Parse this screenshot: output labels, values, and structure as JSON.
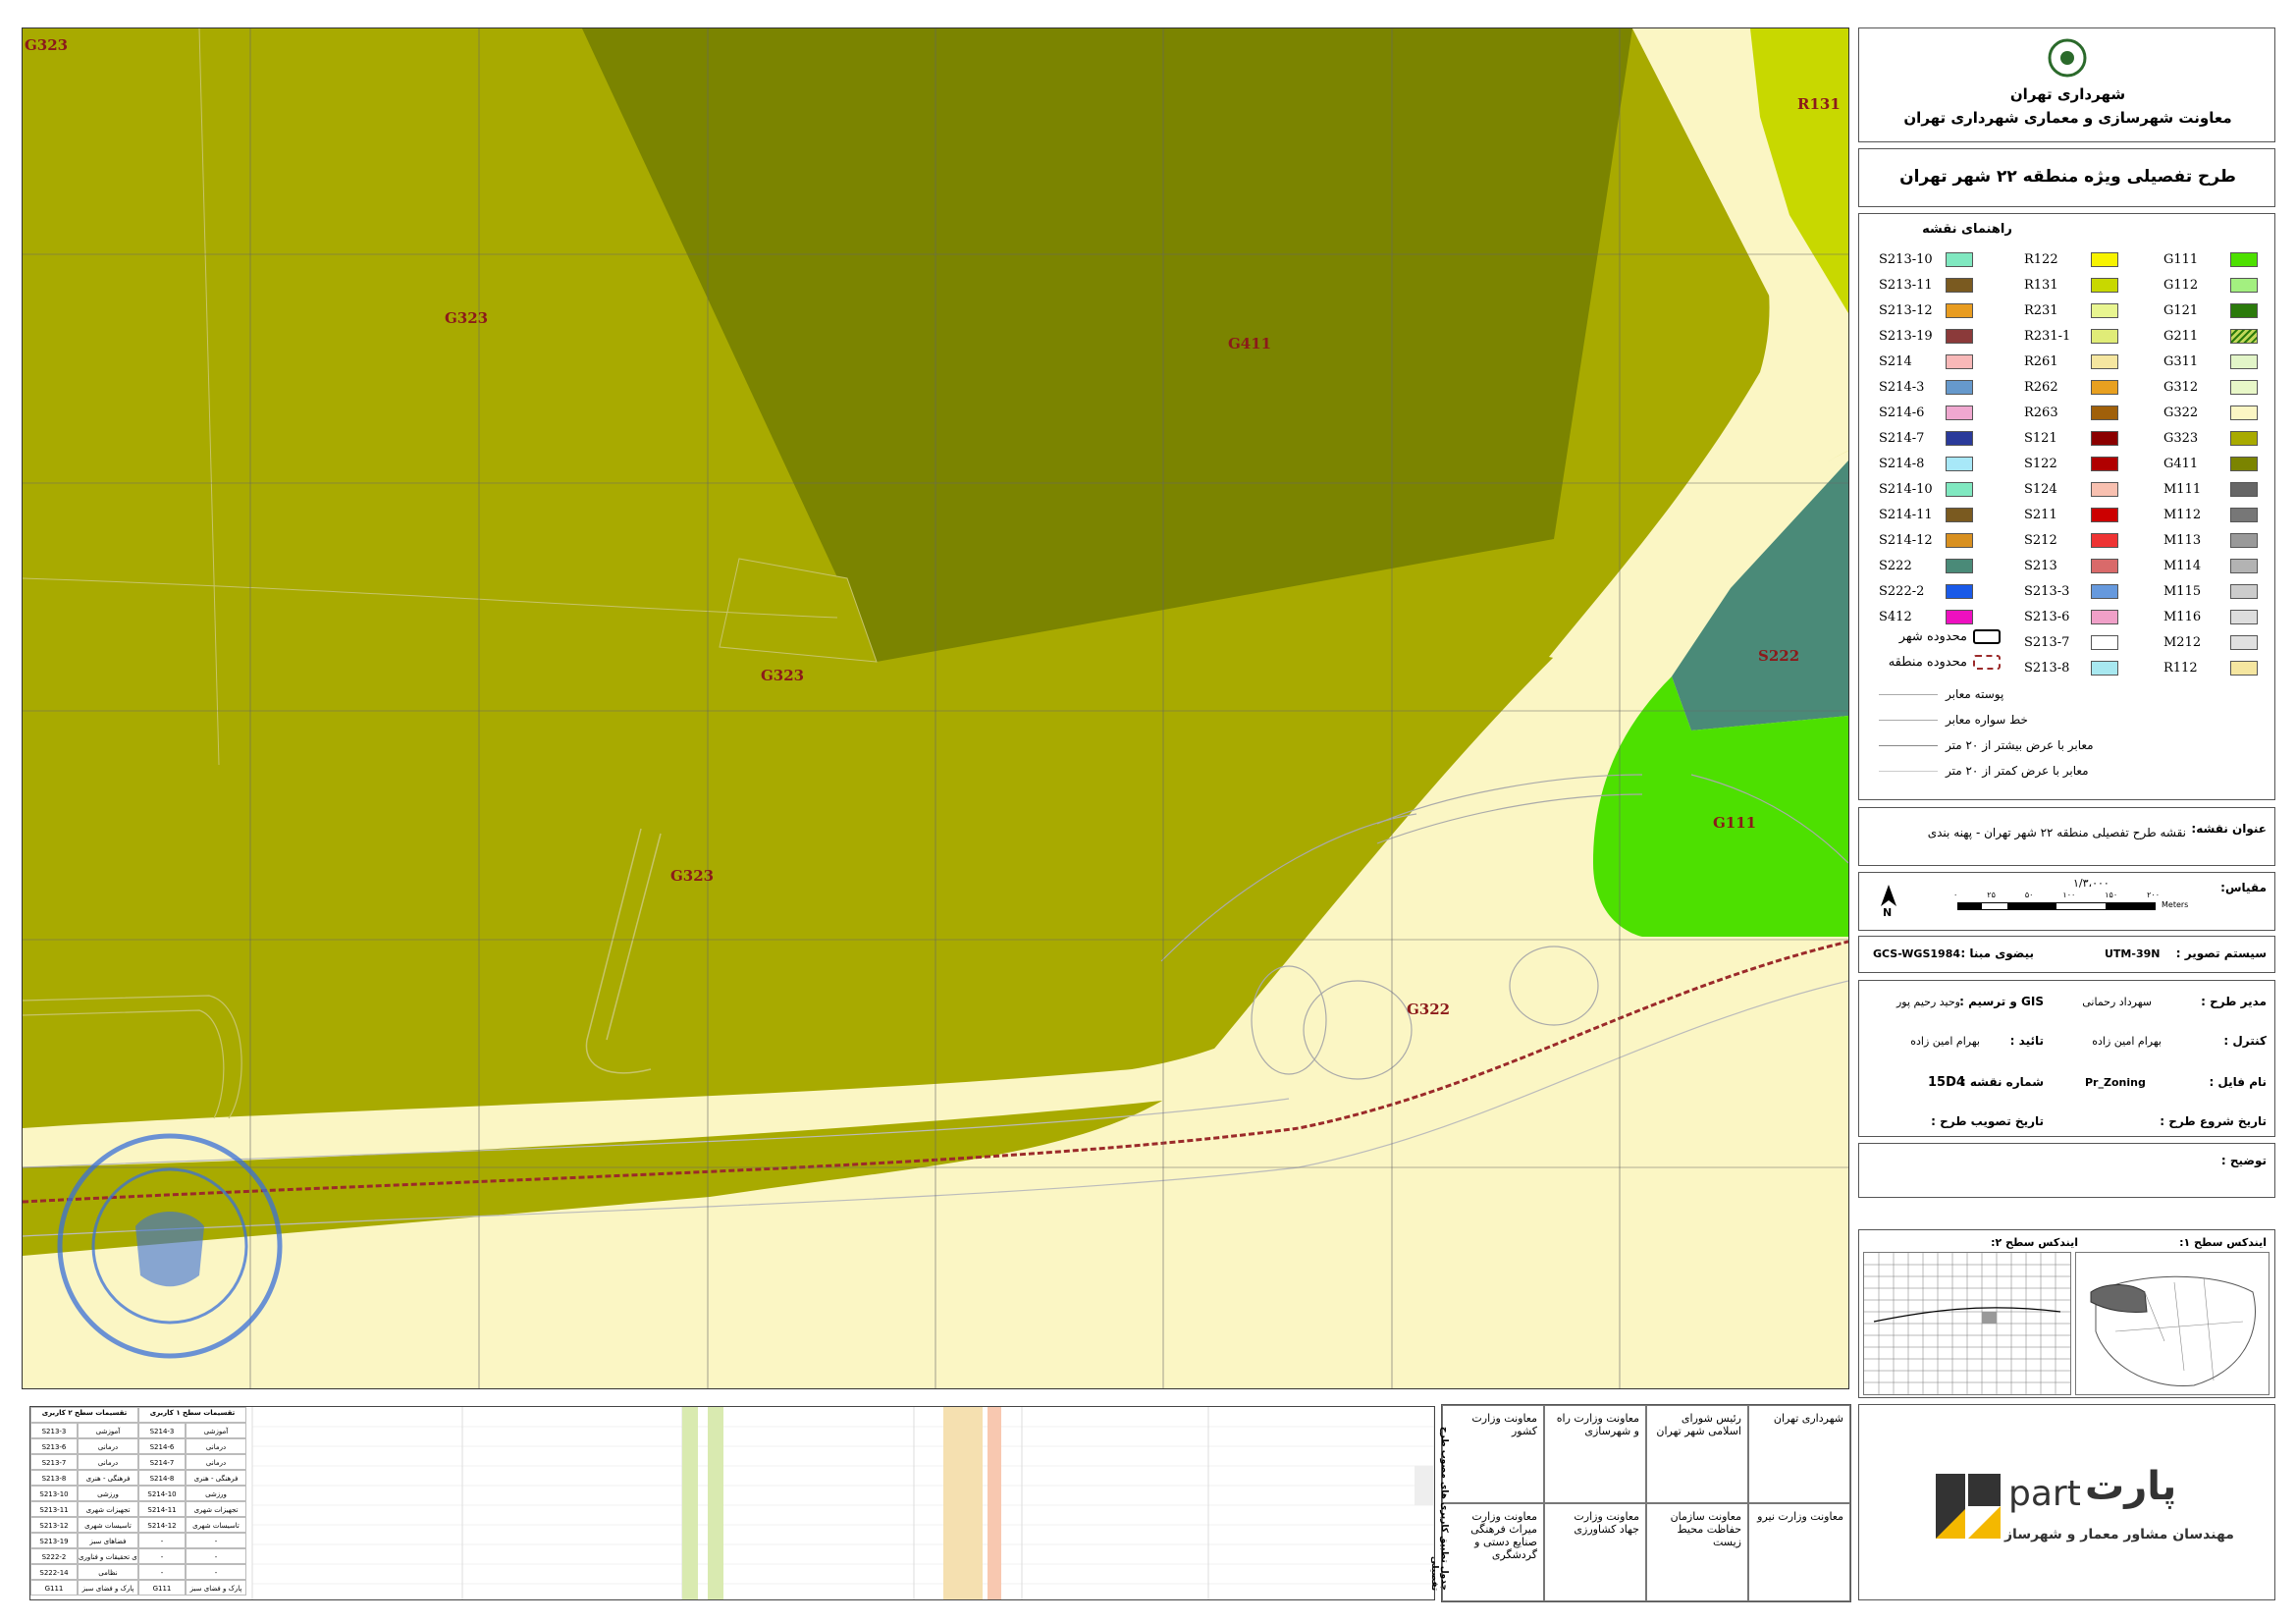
{
  "map": {
    "zone_labels": [
      {
        "id": "g323-a",
        "text": "G323"
      },
      {
        "id": "g323-b",
        "text": "G323"
      },
      {
        "id": "g323-c",
        "text": "G323"
      },
      {
        "id": "g323-d",
        "text": "G323"
      },
      {
        "id": "g411",
        "text": "G411"
      },
      {
        "id": "r131",
        "text": "R131"
      },
      {
        "id": "s222",
        "text": "S222"
      },
      {
        "id": "g111",
        "text": "G111"
      },
      {
        "id": "g322",
        "text": "G322"
      }
    ],
    "colors": {
      "G323": "#a8aa00",
      "G411": "#7b8400",
      "G322": "#fbf6c4",
      "R131": "#c8d800",
      "S222": "#4a8a78",
      "G111": "#4de000",
      "boundary": "#9b2a2a"
    }
  },
  "stamp": {
    "text": "شورای اسلامی شهر تهران"
  },
  "header": {
    "org_name": "شهرداری تهران",
    "org_sub": "معاونت شهرسازی و معماری شهرداری تهران",
    "plan_title": "طرح تفصیلی ویژه منطقه ۲۲ شهر تهران"
  },
  "legend": {
    "title": "راهنمای نقشه",
    "col1": [
      {
        "code": "G111",
        "color": "#4de000"
      },
      {
        "code": "G112",
        "color": "#a3f080"
      },
      {
        "code": "G121",
        "color": "#2b7a0b"
      },
      {
        "code": "G211",
        "color": "#c2d85a"
      },
      {
        "code": "G311",
        "color": "#e2f5c8"
      },
      {
        "code": "G312",
        "color": "#e8f7c8"
      },
      {
        "code": "G322",
        "color": "#fbf6c4"
      },
      {
        "code": "G323",
        "color": "#a8aa00"
      },
      {
        "code": "G411",
        "color": "#7b8400"
      },
      {
        "code": "M111",
        "color": "#666666"
      },
      {
        "code": "M112",
        "color": "#777777"
      },
      {
        "code": "M113",
        "color": "#999999"
      },
      {
        "code": "M114",
        "color": "#b3b3b3"
      },
      {
        "code": "M115",
        "color": "#cccccc"
      },
      {
        "code": "M116",
        "color": "#dddddd"
      },
      {
        "code": "M212",
        "color": "#e0e0e0"
      },
      {
        "code": "R112",
        "color": "#f5e6a0"
      }
    ],
    "col2": [
      {
        "code": "R122",
        "color": "#f7f300"
      },
      {
        "code": "R131",
        "color": "#c8d800"
      },
      {
        "code": "R231",
        "color": "#e8f590"
      },
      {
        "code": "R231-1",
        "color": "#e0ec78"
      },
      {
        "code": "R261",
        "color": "#f5e6a0"
      },
      {
        "code": "R262",
        "color": "#e8a020"
      },
      {
        "code": "R263",
        "color": "#a0600a"
      },
      {
        "code": "S121",
        "color": "#8b0000"
      },
      {
        "code": "S122",
        "color": "#b00000"
      },
      {
        "code": "S124",
        "color": "#f8c0b0"
      },
      {
        "code": "S211",
        "color": "#cc0000"
      },
      {
        "code": "S212",
        "color": "#ee3333"
      },
      {
        "code": "S213",
        "color": "#d96a6a"
      },
      {
        "code": "S213-3",
        "color": "#6699dd"
      },
      {
        "code": "S213-6",
        "color": "#f0a0c8"
      },
      {
        "code": "S213-7",
        "color": "#ffffff"
      },
      {
        "code": "S213-8",
        "color": "#a8e8f0"
      }
    ],
    "col3": [
      {
        "code": "S213-10",
        "color": "#80e8c0"
      },
      {
        "code": "S213-11",
        "color": "#7a5a20"
      },
      {
        "code": "S213-12",
        "color": "#e89c20"
      },
      {
        "code": "S213-19",
        "color": "#8b3a3a"
      },
      {
        "code": "S214",
        "color": "#f8b8b8"
      },
      {
        "code": "S214-3",
        "color": "#6699cc"
      },
      {
        "code": "S214-6",
        "color": "#f0a8d0"
      },
      {
        "code": "S214-7",
        "color": "#2a3a9a"
      },
      {
        "code": "S214-8",
        "color": "#a8e8f8"
      },
      {
        "code": "S214-10",
        "color": "#80e8c0"
      },
      {
        "code": "S214-11",
        "color": "#7a5a20"
      },
      {
        "code": "S214-12",
        "color": "#d89020"
      },
      {
        "code": "S222",
        "color": "#4a8a78"
      },
      {
        "code": "S222-2",
        "color": "#1a5ae8"
      },
      {
        "code": "S412",
        "color": "#ee10c0"
      }
    ],
    "boundaries": [
      {
        "label": "محدوده شهر"
      },
      {
        "label": "محدوده منطقه"
      }
    ],
    "lines": [
      {
        "label": "پوسته معابر"
      },
      {
        "label": "خط سواره معابر"
      },
      {
        "label": "معابر با عرض بیشتر از ۲۰ متر"
      },
      {
        "label": "معابر با عرض کمتر از ۲۰ متر"
      }
    ]
  },
  "map_title": {
    "label": "عنوان نقشه:",
    "value": "نقشه طرح تفصیلی منطقه ۲۲ شهر تهران - پهنه بندی"
  },
  "scale": {
    "label": "مقیاس:",
    "ratio": "۱/۳،۰۰۰",
    "ticks": [
      "۰",
      "۲۵",
      "۵۰",
      "۱۰۰",
      "۱۵۰",
      "۲۰۰"
    ],
    "unit": "Meters",
    "north": "N"
  },
  "projection": {
    "sys_label": "سیستم تصویر :",
    "sys_value": "UTM-39N",
    "datum_label": "بیضوی مبنا :",
    "datum_value": "GCS-WGS1984"
  },
  "credits": {
    "manager_label": "مدیر طرح :",
    "manager_value": "سهرداد رحمانی",
    "gis_label": "GIS و ترسیم :",
    "gis_value": "وحید رحیم پور",
    "control_label": "کنترل :",
    "control_value": "بهرام امین زاده",
    "approve_label": "تائید :",
    "approve_value": "بهرام امین زاده",
    "file_label": "نام فایل :",
    "file_value": "Pr_Zoning",
    "sheet_label": "شماره نقشه :",
    "sheet_value": "15D4",
    "start_label": "تاریخ شروع طرح :",
    "approve_date_label": "تاریخ تصویب طرح :",
    "notes_label": "توضیح :"
  },
  "index": {
    "level1_label": "ایندکس سطح ۱:",
    "level2_label": "ایندکس سطح ۲:"
  },
  "orgs": [
    {
      "text": "شهرداری تهران"
    },
    {
      "text": "رئیس شورای اسلامی شهر تهران"
    },
    {
      "text": "معاونت وزارت راه و شهرسازی"
    },
    {
      "text": "معاونت وزارت کشور"
    },
    {
      "text": "معاونت وزارت نیرو"
    },
    {
      "text": "معاونت سازمان حفاظت محیط زیست"
    },
    {
      "text": "معاونت وزارت جهاد کشاورزی"
    },
    {
      "text": "معاونت وزارت میراث فرهنگی صنایع دستی و گردشگری"
    }
  ],
  "consultant": {
    "brand_fa": "پارت",
    "brand_en": "part",
    "subtitle": "مهندسان مشاور معمار و شهرساز"
  },
  "bottom_table": {
    "side_title": "جدول تطبیق کاربری های مصوب طرح تفصیلی",
    "headers": [
      "تقسیمات سطح ۲ کاربری",
      "تقسیمات سطح ۱ کاربری"
    ],
    "rows": [
      [
        "S213-3",
        "آموزشی",
        "S214-3",
        "آموزشی"
      ],
      [
        "S213-6",
        "درمانی",
        "S214-6",
        "درمانی"
      ],
      [
        "S213-7",
        "درمانی",
        "S214-7",
        "درمانی"
      ],
      [
        "S213-8",
        "فرهنگی - هنری",
        "S214-8",
        "فرهنگی - هنری"
      ],
      [
        "S213-10",
        "ورزشی",
        "S214-10",
        "ورزشی"
      ],
      [
        "S213-11",
        "تجهیزات شهری",
        "S214-11",
        "تجهیزات شهری"
      ],
      [
        "S213-12",
        "تاسیسات شهری",
        "S214-12",
        "تاسیسات شهری"
      ],
      [
        "S213-19",
        "فضاهای سبز",
        "-",
        "-"
      ],
      [
        "S222-2",
        "آموزش های تحقیقات و فناوری",
        "-",
        "-"
      ],
      [
        "S222-14",
        "نظامی",
        "-",
        "-"
      ],
      [
        "G111",
        "پارک و فضای سبز",
        "G111",
        "پارک و فضای سبز"
      ]
    ]
  }
}
